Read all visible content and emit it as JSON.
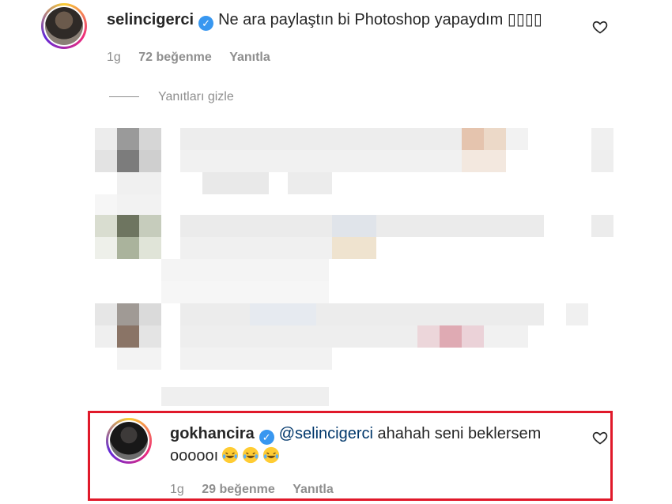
{
  "comment1": {
    "username": "selincigerci",
    "text": "Ne ara paylaştın bi Photoshop yapaydım ▯▯▯▯",
    "time": "1g",
    "likes": "72 beğenme",
    "reply": "Yanıtla"
  },
  "hide_replies": "Yanıtları gizle",
  "comment2": {
    "username": "gokhancira",
    "mention": "@selincigerci",
    "text_line1": "ahahah seni beklersem",
    "text_line2": "oooooı",
    "time": "1g",
    "likes": "29 beğenme",
    "reply": "Yanıtla"
  },
  "colors": {
    "verified": "#3897f0",
    "highlight": "#e0192a",
    "muted": "#8e8e8e",
    "mention": "#00376b"
  },
  "icons": [
    "verified-badge-icon",
    "heart-icon",
    "laughing-emoji-icon"
  ]
}
